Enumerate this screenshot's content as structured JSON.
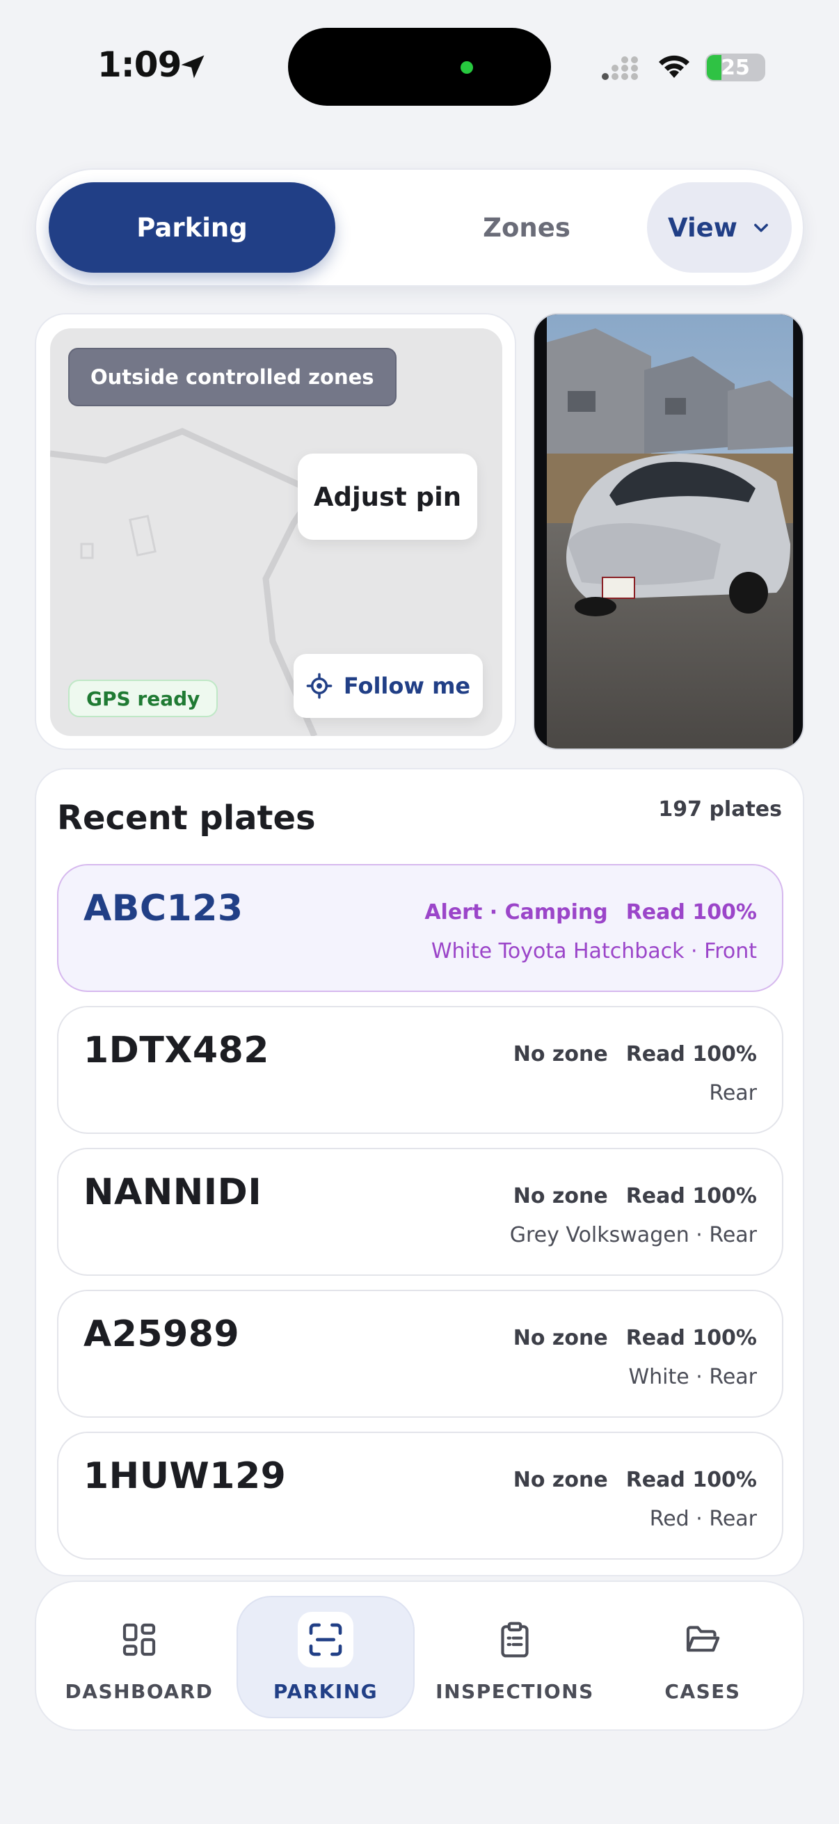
{
  "status_bar": {
    "time": "1:09",
    "battery": "25"
  },
  "colors": {
    "primary": "#213f86",
    "alert": "#9b45c9",
    "gps_green": "#1f7a33",
    "background": "#f2f3f6"
  },
  "header": {
    "tabs": [
      "Parking",
      "Zones"
    ],
    "active_tab": "Parking",
    "view_label": "View"
  },
  "map": {
    "zone_status": "Outside controlled zones",
    "adjust_pin_label": "Adjust pin",
    "gps_status": "GPS ready",
    "follow_label": "Follow me"
  },
  "plates": {
    "title": "Recent plates",
    "count": "197 plates",
    "items": [
      {
        "plate": "ABC123",
        "zone": "Alert · Camping",
        "read": "Read 100%",
        "detail": "White Toyota Hatchback · Front",
        "alert": true
      },
      {
        "plate": "1DTX482",
        "zone": "No zone",
        "read": "Read 100%",
        "detail": "Rear",
        "alert": false
      },
      {
        "plate": "NANNIDI",
        "zone": "No zone",
        "read": "Read 100%",
        "detail": "Grey Volkswagen · Rear",
        "alert": false
      },
      {
        "plate": "A25989",
        "zone": "No zone",
        "read": "Read 100%",
        "detail": "White · Rear",
        "alert": false
      },
      {
        "plate": "1HUW129",
        "zone": "No zone",
        "read": "Read 100%",
        "detail": "Red · Rear",
        "alert": false
      }
    ]
  },
  "nav": {
    "items": [
      {
        "label": "DASHBOARD",
        "icon": "dashboard-icon"
      },
      {
        "label": "PARKING",
        "icon": "scan-icon"
      },
      {
        "label": "INSPECTIONS",
        "icon": "clipboard-icon"
      },
      {
        "label": "CASES",
        "icon": "folder-icon"
      }
    ],
    "active": "PARKING"
  }
}
